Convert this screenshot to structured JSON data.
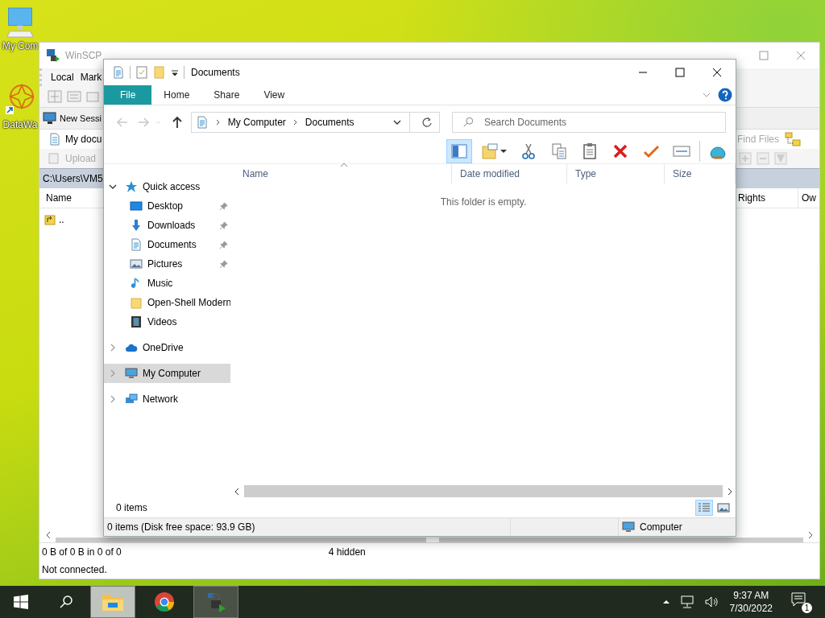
{
  "desktop_icons": [
    {
      "label": "My Com",
      "kind": "computer"
    },
    {
      "label": "DataWa",
      "kind": "app"
    }
  ],
  "winscp": {
    "title": "WinSCP",
    "menu": [
      "Local",
      "Mark"
    ],
    "new_session": "New Sessi",
    "session_tab": "My docu",
    "upload": {
      "label": "Upload",
      "disabled": true
    },
    "find_files": {
      "label": "Find Files",
      "disabled": true
    },
    "path": "C:\\Users\\VM5",
    "left_columns": [
      "Name"
    ],
    "left_rows": [
      ".."
    ],
    "right_columns": [
      "Rights",
      "Ow"
    ],
    "status": {
      "selection": "0 B of 0 B in 0 of 0",
      "hidden": "4 hidden",
      "connection": "Not connected."
    }
  },
  "explorer": {
    "title": "Documents",
    "ribbon_tabs": [
      {
        "label": "File",
        "selected": true
      },
      {
        "label": "Home",
        "selected": false
      },
      {
        "label": "Share",
        "selected": false
      },
      {
        "label": "View",
        "selected": false
      }
    ],
    "nav_buttons": [
      {
        "kind": "back",
        "disabled": true
      },
      {
        "kind": "forward",
        "disabled": true
      },
      {
        "kind": "recent",
        "disabled": true
      },
      {
        "kind": "up",
        "disabled": false
      }
    ],
    "breadcrumb": [
      "My Computer",
      "Documents"
    ],
    "search": {
      "placeholder": "Search Documents"
    },
    "toolbar": [
      {
        "kind": "pane",
        "selected": true
      },
      {
        "kind": "new-folder",
        "selected": false
      },
      {
        "kind": "cut",
        "selected": false
      },
      {
        "kind": "copy",
        "selected": false
      },
      {
        "kind": "paste",
        "selected": false
      },
      {
        "kind": "delete",
        "selected": false
      },
      {
        "kind": "check",
        "selected": false
      },
      {
        "kind": "rename",
        "selected": false
      },
      {
        "kind": "shell",
        "selected": false
      }
    ],
    "nav": [
      {
        "label": "Quick access",
        "kind": "star",
        "expanded": true,
        "selected": false,
        "children": [
          {
            "label": "Desktop",
            "kind": "desktop",
            "pinned": true,
            "selected": false
          },
          {
            "label": "Downloads",
            "kind": "download",
            "pinned": true,
            "selected": false
          },
          {
            "label": "Documents",
            "kind": "document",
            "pinned": true,
            "selected": false
          },
          {
            "label": "Pictures",
            "kind": "picture",
            "pinned": true,
            "selected": false
          },
          {
            "label": "Music",
            "kind": "music",
            "pinned": false,
            "selected": false
          },
          {
            "label": "Open-Shell Modern",
            "kind": "folder",
            "pinned": false,
            "selected": false
          },
          {
            "label": "Videos",
            "kind": "video",
            "pinned": false,
            "selected": false
          }
        ]
      },
      {
        "label": "OneDrive",
        "kind": "cloud",
        "expanded": false,
        "selected": false
      },
      {
        "label": "My Computer",
        "kind": "computer",
        "expanded": false,
        "selected": true
      },
      {
        "label": "Network",
        "kind": "network",
        "expanded": false,
        "selected": false
      }
    ],
    "columns": [
      "Name",
      "Date modified",
      "Type",
      "Size"
    ],
    "empty_message": "This folder is empty.",
    "item_count": "0 items",
    "view_buttons": [
      {
        "kind": "details",
        "selected": true
      },
      {
        "kind": "tiles",
        "selected": false
      }
    ],
    "status": "0 items (Disk free space: 93.9 GB)",
    "status_location": "Computer"
  },
  "taskbar": {
    "apps": [
      {
        "kind": "explorer",
        "open": true,
        "selected": true
      },
      {
        "kind": "chrome",
        "open": false,
        "selected": false
      },
      {
        "kind": "winscp",
        "open": true,
        "selected": false
      }
    ],
    "time": "9:37 AM",
    "date": "7/30/2022",
    "notifications": "1"
  }
}
